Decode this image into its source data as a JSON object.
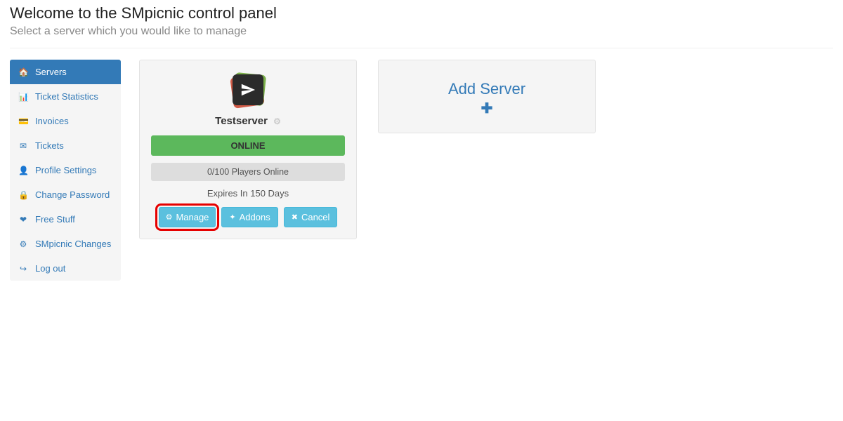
{
  "header": {
    "title": "Welcome to the SMpicnic control panel",
    "subtitle": "Select a server which you would like to manage"
  },
  "sidebar": {
    "items": [
      {
        "icon": "🏠",
        "label": "Servers",
        "active": true,
        "name": "sidebar-item-servers"
      },
      {
        "icon": "📊",
        "label": "Ticket Statistics",
        "active": false,
        "name": "sidebar-item-ticket-stats"
      },
      {
        "icon": "💳",
        "label": "Invoices",
        "active": false,
        "name": "sidebar-item-invoices"
      },
      {
        "icon": "✉",
        "label": "Tickets",
        "active": false,
        "name": "sidebar-item-tickets"
      },
      {
        "icon": "👤",
        "label": "Profile Settings",
        "active": false,
        "name": "sidebar-item-profile"
      },
      {
        "icon": "🔒",
        "label": "Change Password",
        "active": false,
        "name": "sidebar-item-password"
      },
      {
        "icon": "❤",
        "label": "Free Stuff",
        "active": false,
        "name": "sidebar-item-free-stuff"
      },
      {
        "icon": "⚙",
        "label": "SMpicnic Changes",
        "active": false,
        "name": "sidebar-item-changes"
      },
      {
        "icon": "↪",
        "label": "Log out",
        "active": false,
        "name": "sidebar-item-logout"
      }
    ]
  },
  "server": {
    "name": "Testserver",
    "status": "ONLINE",
    "players_text": "0/100 Players Online",
    "expires_text": "Expires In 150 Days",
    "manage_label": "Manage",
    "addons_label": "Addons",
    "cancel_label": "Cancel"
  },
  "add_server": {
    "title": "Add Server",
    "plus": "✚"
  },
  "colors": {
    "primary": "#337ab7",
    "success": "#5cb85c",
    "info": "#5bc0de",
    "highlight": "#e60000"
  }
}
